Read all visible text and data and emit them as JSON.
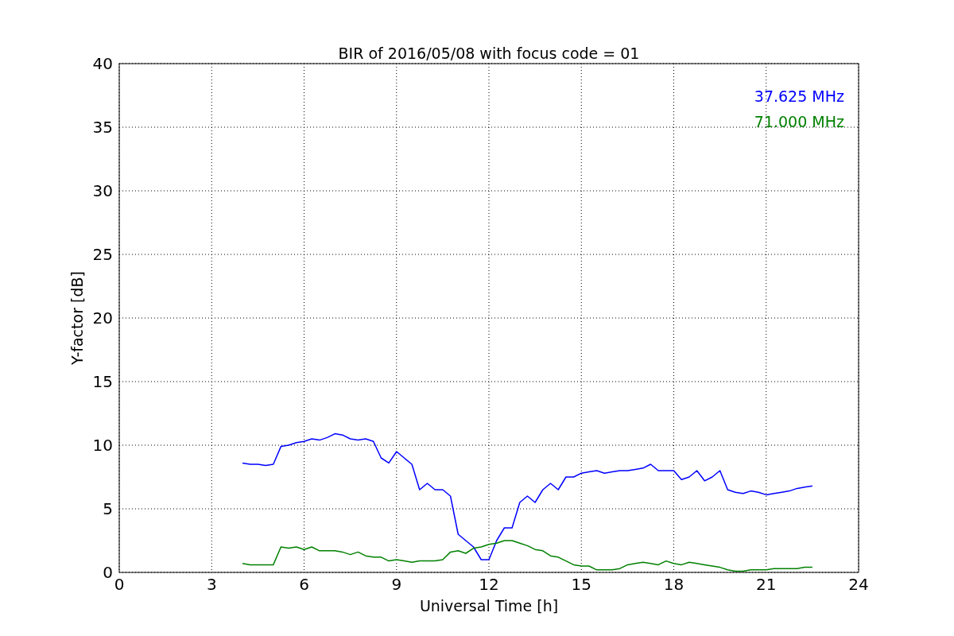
{
  "chart_data": {
    "type": "line",
    "title": "BIR of 2016/05/08 with focus code = 01",
    "xlabel": "Universal Time [h]",
    "ylabel": "Y-factor [dB]",
    "x": [
      4.0,
      4.25,
      4.5,
      4.75,
      5.0,
      5.25,
      5.5,
      5.75,
      6.0,
      6.25,
      6.5,
      6.75,
      7.0,
      7.25,
      7.5,
      7.75,
      8.0,
      8.25,
      8.5,
      8.75,
      9.0,
      9.25,
      9.5,
      9.75,
      10.0,
      10.25,
      10.5,
      10.75,
      11.0,
      11.25,
      11.5,
      11.75,
      12.0,
      12.25,
      12.5,
      12.75,
      13.0,
      13.25,
      13.5,
      13.75,
      14.0,
      14.25,
      14.5,
      14.75,
      15.0,
      15.25,
      15.5,
      15.75,
      16.0,
      16.25,
      16.5,
      16.75,
      17.0,
      17.25,
      17.5,
      17.75,
      18.0,
      18.25,
      18.5,
      18.75,
      19.0,
      19.25,
      19.5,
      19.75,
      20.0,
      20.25,
      20.5,
      20.75,
      21.0,
      21.25,
      21.5,
      21.75,
      22.0,
      22.25,
      22.5
    ],
    "series": [
      {
        "name": "37.625 MHz",
        "color": "#0000ff",
        "values": [
          8.6,
          8.5,
          8.5,
          8.4,
          8.5,
          9.9,
          10.0,
          10.2,
          10.3,
          10.5,
          10.4,
          10.6,
          10.9,
          10.8,
          10.5,
          10.4,
          10.5,
          10.3,
          9.0,
          8.6,
          9.5,
          9.0,
          8.5,
          6.5,
          7.0,
          6.5,
          6.5,
          6.0,
          3.0,
          2.5,
          2.0,
          1.0,
          1.0,
          2.5,
          3.5,
          3.5,
          5.5,
          6.0,
          5.5,
          6.5,
          7.0,
          6.5,
          7.5,
          7.5,
          7.8,
          7.9,
          8.0,
          7.8,
          7.9,
          8.0,
          8.0,
          8.1,
          8.2,
          8.5,
          8.0,
          8.0,
          8.0,
          7.3,
          7.5,
          8.0,
          7.2,
          7.5,
          8.0,
          6.5,
          6.3,
          6.2,
          6.4,
          6.3,
          6.1,
          6.2,
          6.3,
          6.4,
          6.6,
          6.7,
          6.8
        ]
      },
      {
        "name": "71.000 MHz",
        "color": "#008000",
        "values": [
          0.7,
          0.6,
          0.6,
          0.6,
          0.6,
          2.0,
          1.9,
          2.0,
          1.8,
          2.0,
          1.7,
          1.7,
          1.7,
          1.6,
          1.4,
          1.6,
          1.3,
          1.2,
          1.2,
          0.9,
          1.0,
          0.9,
          0.8,
          0.9,
          0.9,
          0.9,
          1.0,
          1.6,
          1.7,
          1.5,
          1.9,
          2.0,
          2.2,
          2.3,
          2.5,
          2.5,
          2.3,
          2.1,
          1.8,
          1.7,
          1.3,
          1.2,
          0.9,
          0.6,
          0.5,
          0.5,
          0.2,
          0.2,
          0.2,
          0.3,
          0.6,
          0.7,
          0.8,
          0.7,
          0.6,
          0.9,
          0.7,
          0.6,
          0.8,
          0.7,
          0.6,
          0.5,
          0.4,
          0.2,
          0.1,
          0.1,
          0.2,
          0.2,
          0.2,
          0.3,
          0.3,
          0.3,
          0.3,
          0.4,
          0.4
        ]
      }
    ],
    "xlim": [
      0,
      24
    ],
    "ylim": [
      0,
      40
    ],
    "xticks": [
      0,
      3,
      6,
      9,
      12,
      15,
      18,
      21,
      24
    ],
    "yticks": [
      0,
      5,
      10,
      15,
      20,
      25,
      30,
      35,
      40
    ],
    "grid": true
  }
}
